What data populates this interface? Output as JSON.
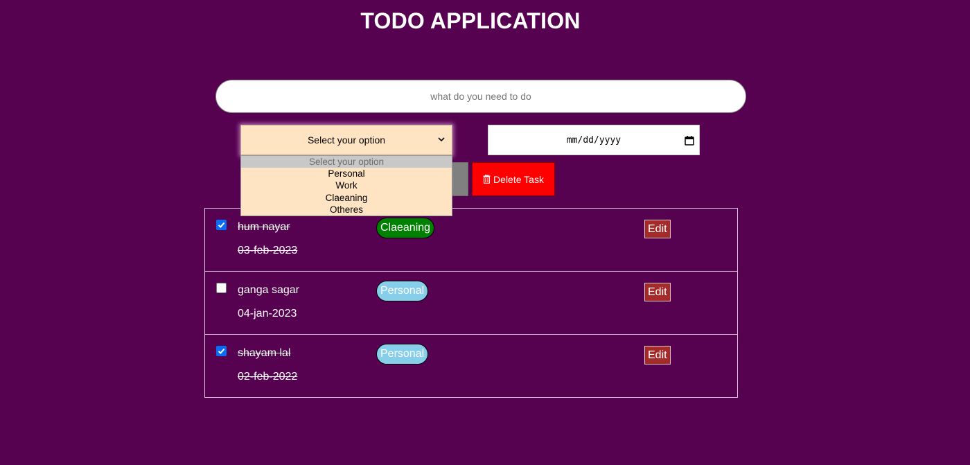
{
  "app": {
    "title": "TODO APPLICATION"
  },
  "task_input": {
    "placeholder": "what do you need to do",
    "value": ""
  },
  "category_select": {
    "selected_label": "Select your option",
    "options": [
      "Select your option",
      "Personal",
      "Work",
      "Claeaning",
      "Otheres"
    ],
    "expanded": true
  },
  "date_input": {
    "placeholder": "mm/dd/yyyy"
  },
  "delete_button": {
    "label": "Delete Task",
    "icon": "trash-icon",
    "color": "#ff0000"
  },
  "tasks": [
    {
      "name": "hum nayar",
      "date": "03-feb-2023",
      "category": "Claeaning",
      "category_color": "#008000",
      "checked": true,
      "edit_label": "Edit"
    },
    {
      "name": "ganga sagar",
      "date": "04-jan-2023",
      "category": "Personal",
      "category_color": "#87ceeb",
      "checked": false,
      "edit_label": "Edit"
    },
    {
      "name": "shayam lal",
      "date": "02-feb-2022",
      "category": "Personal",
      "category_color": "#87ceeb",
      "checked": true,
      "edit_label": "Edit"
    }
  ],
  "colors": {
    "background": "#560251",
    "select_background": "#ffe4c4",
    "edit_button": "#a52a2a",
    "checkbox_checked": "#0a6cf5"
  }
}
